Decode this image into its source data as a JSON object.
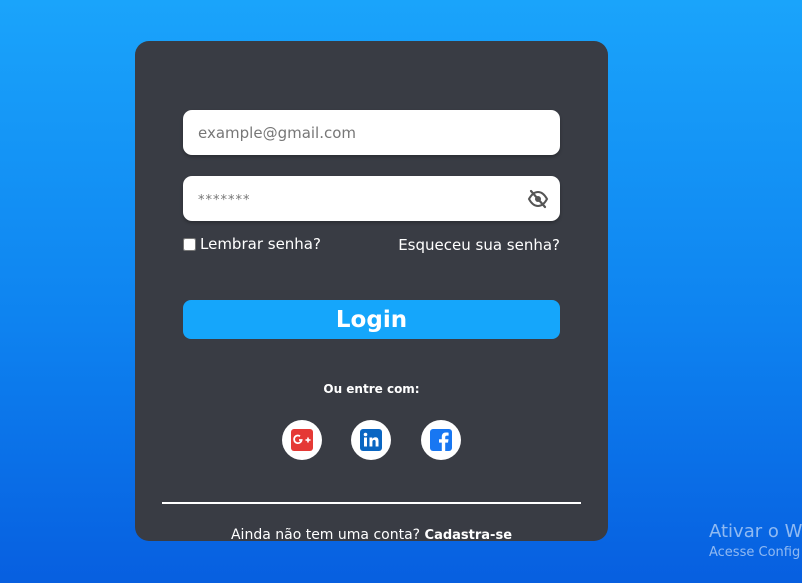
{
  "login_form": {
    "email": {
      "placeholder": "example@gmail.com",
      "value": ""
    },
    "password": {
      "placeholder": "*******",
      "value": ""
    },
    "eye_icon": "eye-slash-icon",
    "remember_label": "Lembrar senha?",
    "remember_checked": false,
    "forgot_label": "Esqueceu sua senha?",
    "login_label": "Login",
    "alt_text": "Ou entre com:",
    "social": [
      {
        "name": "google-plus-icon",
        "color": "#e53935"
      },
      {
        "name": "linkedin-icon",
        "color": "#0a66c2"
      },
      {
        "name": "facebook-icon",
        "color": "#1877f2"
      }
    ],
    "signup_prompt": "Ainda não tem uma conta?",
    "signup_link": "Cadastra-se"
  },
  "watermark": {
    "title": "Ativar o W",
    "subtitle": "Acesse Config"
  },
  "colors": {
    "card": "#393c44",
    "accent": "#15a6fb",
    "background_top": "#1aa4fb",
    "background_bottom": "#075fe0"
  }
}
